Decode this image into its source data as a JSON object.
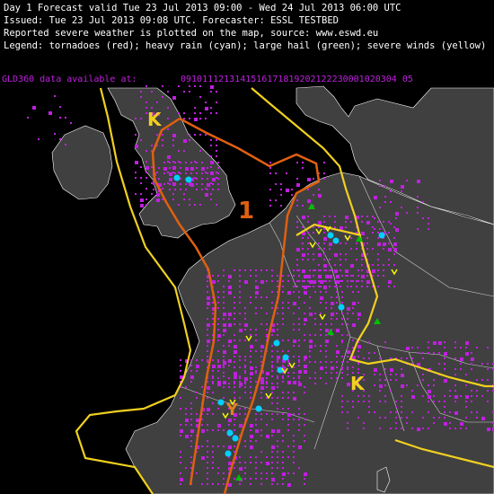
{
  "header": {
    "line1": "Day 1 Forecast valid Tue 23 Jul 2013 09:00 - Wed 24 Jul 2013 06:00 UTC",
    "line2": "Issued: Tue 23 Jul 2013 09:08 UTC. Forecaster: ESSL TESTBED",
    "line3": "Reported severe weather is plotted on the map, source: www.eswd.eu",
    "line4": "Legend: tornadoes (red); heavy rain (cyan); large hail (green); severe winds (yellow)"
  },
  "lightning": {
    "label": "GLD360 data available at:",
    "hours": "0910111213141516171819202122230001020304 05",
    "color": "#c020e0"
  },
  "levels": {
    "level1_label": "1",
    "level1_color": "#e06010",
    "lightning_area_color": "#f0d020"
  },
  "colors": {
    "land": "#404040",
    "sea": "#000000",
    "heavy_rain": "#00d0ff",
    "large_hail": "#00c000",
    "severe_winds": "#ffff00",
    "tornado": "#ff0000",
    "lightning": "#c020e0"
  }
}
